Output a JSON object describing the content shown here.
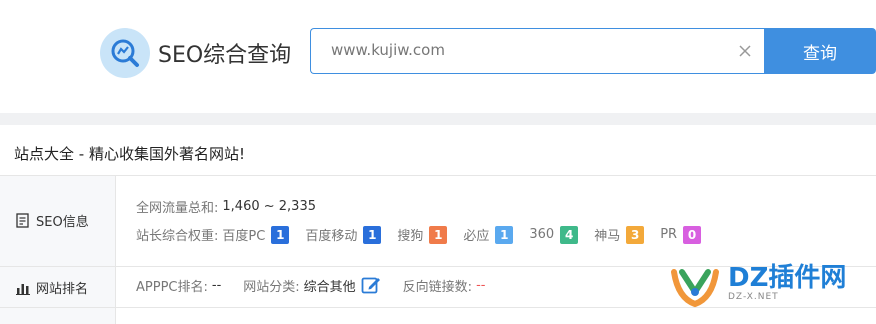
{
  "header": {
    "logo_text": "SEO综合查询",
    "search_value": "www.kujiw.com",
    "search_button": "查询"
  },
  "panel": {
    "title": "站点大全 - 精心收集国外著名网站!",
    "seo_label": "SEO信息",
    "rank_label": "网站排名",
    "traffic_label": "全网流量总和:",
    "traffic_value": "1,460 ~ 2,335",
    "weight_label": "站长综合权重:",
    "weights": [
      {
        "name": "百度PC",
        "value": "1",
        "color": "#2a6fdb"
      },
      {
        "name": "百度移动",
        "value": "1",
        "color": "#2a6fdb"
      },
      {
        "name": "搜狗",
        "value": "1",
        "color": "#f07b4a"
      },
      {
        "name": "必应",
        "value": "1",
        "color": "#5aa9ef"
      },
      {
        "name": "360",
        "value": "4",
        "color": "#3fb98a"
      },
      {
        "name": "神马",
        "value": "3",
        "color": "#f3a93a"
      },
      {
        "name": "PR",
        "value": "0",
        "color": "#d85fe0"
      }
    ],
    "apppc_label": "APPPC排名:",
    "apppc_value": "--",
    "category_label": "网站分类:",
    "category_value": "综合其他",
    "backlinks_label": "反向链接数:",
    "backlinks_value": "--"
  },
  "watermark": {
    "main": "DZ插件网",
    "sub": "DZ-X.NET"
  },
  "icons": [
    "search-chart-icon",
    "clear-icon",
    "document-icon",
    "bar-chart-icon",
    "edit-icon",
    "dz-logo-icon"
  ],
  "colors": {
    "accent": "#3f8fe0"
  }
}
